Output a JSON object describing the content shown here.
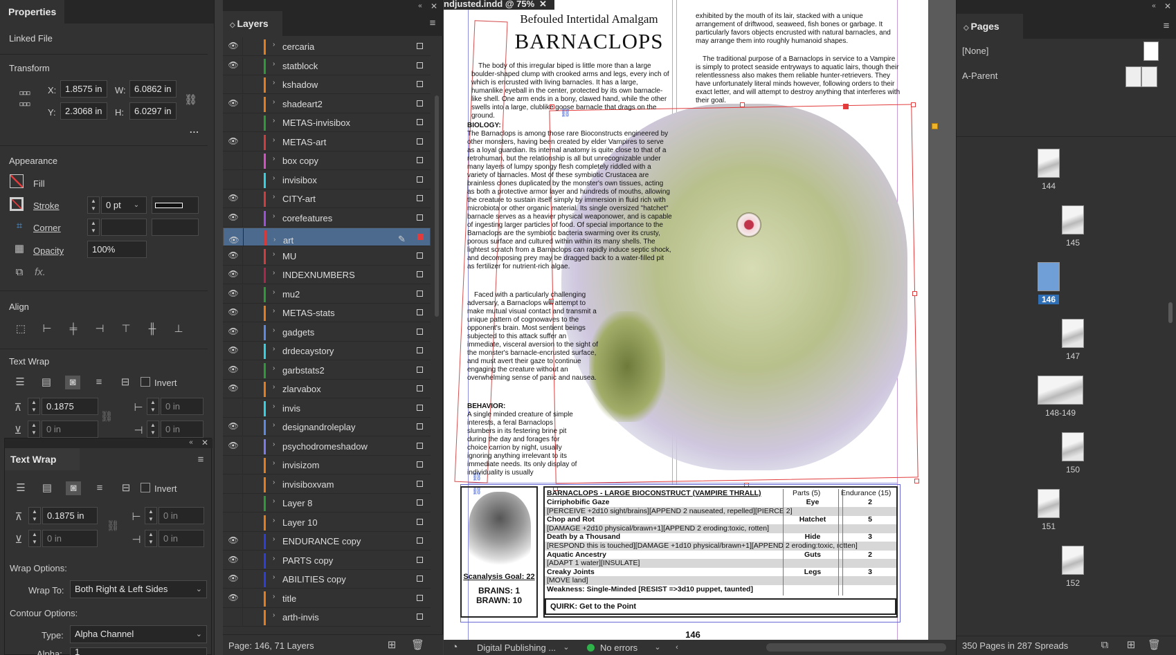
{
  "properties": {
    "tab": "Properties",
    "linked_file": "Linked File",
    "transform": {
      "title": "Transform",
      "x_label": "X:",
      "x": "1.8575 in",
      "y_label": "Y:",
      "y": "2.3068 in",
      "w_label": "W:",
      "w": "6.0862 in",
      "h_label": "H:",
      "h": "6.0297 in",
      "more": "..."
    },
    "appearance": {
      "title": "Appearance",
      "fill": "Fill",
      "stroke": "Stroke",
      "stroke_weight": "0 pt",
      "corner": "Corner",
      "opacity": "Opacity",
      "opacity_value": "100%",
      "fx": "fx."
    },
    "align": {
      "title": "Align"
    },
    "text_wrap": {
      "title": "Text Wrap",
      "invert": "Invert",
      "offset_top": "0.1875",
      "offset_bottom": "0 in",
      "offset_left": "0 in",
      "offset_right": "0 in"
    }
  },
  "text_wrap_panel": {
    "title": "Text Wrap",
    "invert": "Invert",
    "top": "0.1875 in",
    "bottom": "0 in",
    "left": "0 in",
    "right": "0 in",
    "wrap_options": "Wrap Options:",
    "wrap_to_label": "Wrap To:",
    "wrap_to": "Both Right & Left Sides",
    "contour_options": "Contour Options:",
    "type_label": "Type:",
    "type": "Alpha Channel",
    "alpha_label": "Alpha:",
    "alpha": "1"
  },
  "layers": {
    "tab": "Layers",
    "items": [
      {
        "name": "cercaria",
        "color": "#e87d18",
        "visible": true
      },
      {
        "name": "statblock",
        "color": "#2d9a3a",
        "visible": true
      },
      {
        "name": "kshadow",
        "color": "#e87d18",
        "visible": false
      },
      {
        "name": "shadeart2",
        "color": "#e87d18",
        "visible": true
      },
      {
        "name": "METAS-invisibox",
        "color": "#2d9a3a",
        "visible": false
      },
      {
        "name": "METAS-art",
        "color": "#d63b3b",
        "visible": true
      },
      {
        "name": "box copy",
        "color": "#d64fc8",
        "visible": false
      },
      {
        "name": "invisibox",
        "color": "#2fd3e6",
        "visible": false
      },
      {
        "name": "CITY-art",
        "color": "#d63b3b",
        "visible": true
      },
      {
        "name": "corefeatures",
        "color": "#9f4fe0",
        "visible": true
      },
      {
        "name": "art",
        "color": "#d63b3b",
        "visible": true,
        "selected": true
      },
      {
        "name": "MU",
        "color": "#d63b3b",
        "visible": true
      },
      {
        "name": "INDEXNUMBERS",
        "color": "#b0234a",
        "visible": true
      },
      {
        "name": "mu2",
        "color": "#2d9a3a",
        "visible": true
      },
      {
        "name": "METAS-stats",
        "color": "#e87d18",
        "visible": true
      },
      {
        "name": "gadgets",
        "color": "#5a8ae6",
        "visible": true
      },
      {
        "name": "drdecaystory",
        "color": "#2fd3e6",
        "visible": true
      },
      {
        "name": "garbstats2",
        "color": "#2d9a3a",
        "visible": true
      },
      {
        "name": "zlarvabox",
        "color": "#e87d18",
        "visible": true
      },
      {
        "name": "invis",
        "color": "#2fd3e6",
        "visible": false
      },
      {
        "name": "designandroleplay",
        "color": "#5a8ae6",
        "visible": true
      },
      {
        "name": "psychodromeshadow",
        "color": "#7b7bf0",
        "visible": true
      },
      {
        "name": "invisizom",
        "color": "#e87d18",
        "visible": false
      },
      {
        "name": "invisiboxvam",
        "color": "#e87d18",
        "visible": false
      },
      {
        "name": "Layer 8",
        "color": "#2d9a3a",
        "visible": false
      },
      {
        "name": "Layer 10",
        "color": "#e87d18",
        "visible": false
      },
      {
        "name": "ENDURANCE copy",
        "color": "#2b3ee0",
        "visible": true
      },
      {
        "name": "PARTS copy",
        "color": "#2b3ee0",
        "visible": true
      },
      {
        "name": "ABILITIES copy",
        "color": "#2b3ee0",
        "visible": true
      },
      {
        "name": "title",
        "color": "#e87d18",
        "visible": true
      },
      {
        "name": "arth-invis",
        "color": "#e87d18",
        "visible": false
      }
    ],
    "footer": "Page: 146, 71 Layers"
  },
  "document": {
    "tab_title": "ndjusted.indd @ 75%",
    "subtitle": "Befouled Intertidal Amalgam",
    "title": "BARNACLOPS",
    "intro": "The body of this irregular biped is little more than a large boulder-shaped clump with crooked arms and legs, every inch of which is encrusted with living barnacles. It has a large, humanlike eyeball in the center, protected by its own barnacle-like shell. One arm ends in a bony, clawed hand, while the other swells into a large, clublike goose barnacle that drags on the ground.",
    "biology_head": "BIOLOGY:",
    "biology": "The Barnaclops is among those rare Bioconstructs engineered by other monsters, having been created by elder Vampires to serve as a loyal guardian. Its internal anatomy is quite close to that of a retrohuman, but the relationship is all but unrecognizable under many layers of lumpy spongy flesh completely riddled with a variety of barnacles. Most of these symbiotic Crustacea are brainless clones duplicated by the monster's own tissues, acting as both a protective armor layer and hundreds of mouths, allowing the creature to sustain itself simply by immersion in fluid rich with microbiota or other organic material. Its single oversized \"hatchet\" barnacle serves as a heavier physical weaponower, and is capable of ingesting larger particles of food. Of special importance to the Barnaclops are the symbiotic bacteria swarming over its crusty, porous surface and cultured within within its many shells. The lightest scratch from a Barnaclops can rapidly induce septic shock, and decomposing prey may be dragged back to a water-filled pit as fertilizer for nutrient-rich algae.",
    "faced": "Faced with a particularly challenging adversary, a Barnaclops will attempt to make mutual visual contact and transmit a unique pattern of cognowaves to the opponent's brain. Most sentient beings subjected to this attack suffer an immediate, visceral aversion to the sight of the monster's barnacle-encrusted surface, and must avert their gaze to continue engaging the creature without an overwhelming sense of panic and nausea.",
    "behavior_head": "BEHAVIOR:",
    "behavior": "A single minded creature of simple interests, a feral Barnaclops slumbers in its festering brine pit during the day and forages for choice carrion by night, usually ignoring anything irrelevant to its immediate needs. Its only display of individuality is usually",
    "right_col_1": "exhibited by the mouth of its lair, stacked with a unique arrangement of driftwood, seaweed, fish bones or garbage. It particularly favors objects encrusted with natural barnacles, and may arrange them into roughly humanoid shapes.",
    "right_col_2": "The traditional purpose of a Barnaclops in service to a Vampire is simply to protect seaside entryways to aquatic lairs, though their relentlessness also makes them reliable hunter-retrievers. They have unfortunately literal minds however, following orders to their exact letter, and will attempt to destroy anything that interferes with their goal.",
    "stat": {
      "header": "BARNACLOPS - LARGE BIOCONSTRUCT (VAMPIRE THRALL)",
      "parts_head": "Parts (5)",
      "endurance_head": "Endurance (15)",
      "rows": [
        {
          "text": "Cirriphobific Gaze",
          "bold": true,
          "part": "Eye",
          "end": "2",
          "shade": false
        },
        {
          "text": "[PERCEIVE +2d10 sight/brains][APPEND 2 nauseated, repelled][PIERCE 2]",
          "bold": false,
          "part": "",
          "end": "",
          "shade": true
        },
        {
          "text": "Chop and Rot",
          "bold": true,
          "part": "Hatchet",
          "end": "5",
          "shade": false
        },
        {
          "text": "[DAMAGE +2d10 physical/brawn+1][APPEND 2 eroding:toxic, rotten]",
          "bold": false,
          "part": "",
          "end": "",
          "shade": true
        },
        {
          "text": "Death by a Thousand",
          "bold": true,
          "part": "Hide",
          "end": "3",
          "shade": false
        },
        {
          "text": "[RESPOND this is touched][DAMAGE +1d10 physical/brawn+1][APPEND 2 eroding:toxic, rotten]",
          "bold": false,
          "part": "",
          "end": "",
          "shade": true
        },
        {
          "text": "Aquatic Ancestry",
          "bold": true,
          "part": "Guts",
          "end": "2",
          "shade": false
        },
        {
          "text": "[ADAPT 1 water][INSULATE]",
          "bold": false,
          "part": "",
          "end": "",
          "shade": true
        },
        {
          "text": "Creaky Joints",
          "bold": true,
          "part": "Legs",
          "end": "3",
          "shade": false
        },
        {
          "text": "[MOVE land]",
          "bold": false,
          "part": "",
          "end": "",
          "shade": true
        },
        {
          "text": "Weakness: Single-Minded [RESIST =>3d10 puppet, taunted]",
          "bold": true,
          "part": "",
          "end": "",
          "shade": false
        }
      ],
      "quirk": "QUIRK: Get to the Point",
      "scan": "Scanalysis Goal: 22",
      "brains": "BRAINS: 1",
      "brawn": "BRAWN: 10"
    },
    "page_number": "146",
    "status": {
      "workspace": "Digital Publishing ...",
      "errors": "No errors"
    }
  },
  "pages": {
    "tab": "Pages",
    "none": "[None]",
    "parent": "A-Parent",
    "items": [
      {
        "label": "144",
        "current": false
      },
      {
        "label": "145",
        "current": false
      },
      {
        "label": "146",
        "current": true
      },
      {
        "label": "147",
        "current": false
      },
      {
        "label": "148-149",
        "current": false
      },
      {
        "label": "150",
        "current": false
      },
      {
        "label": "151",
        "current": false
      },
      {
        "label": "152",
        "current": false
      }
    ],
    "footer": "350 Pages in 287 Spreads"
  }
}
